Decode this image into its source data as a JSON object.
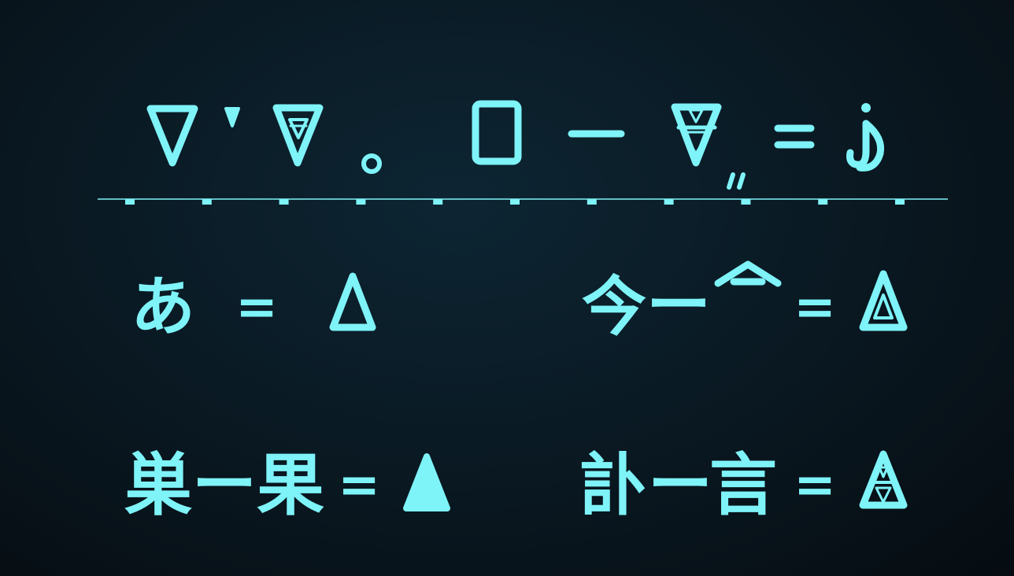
{
  "colors": {
    "accent": "#7ef3f8",
    "background": "#0b1a22"
  },
  "cipher_line": {
    "symbols": [
      "inverted-triangle",
      "small-filled-triangle",
      "nested-inverted-triangle",
      "small-circle",
      "rounded-rectangle",
      "dash",
      "split-inverted-triangle",
      "double-quote-mark",
      "equals-sign",
      "hook-symbol"
    ],
    "tick_count": 11
  },
  "legend": {
    "a_char": "あ",
    "a_symbol": "triangle-outline",
    "kon_char_1": "今",
    "kon_char_2": "ー",
    "kon_char_3": "^",
    "kon_symbol": "nested-triangle",
    "su_char_1": "巣",
    "su_char_2": "ー",
    "su_char_3": "果",
    "su_symbol": "filled-triangle",
    "ji_char_1": "訃",
    "ji_char_2": "ー",
    "ji_char_3": "言",
    "ji_symbol": "split-triangle",
    "equals": "="
  }
}
